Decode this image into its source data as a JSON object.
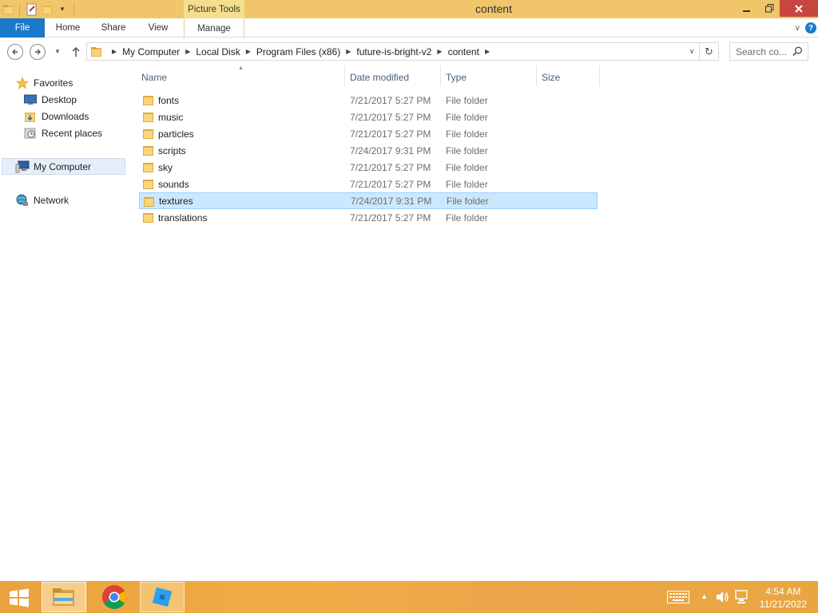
{
  "window": {
    "title": "content",
    "context_tab_group": "Picture Tools"
  },
  "ribbon": {
    "tabs": [
      {
        "label": "File"
      },
      {
        "label": "Home"
      },
      {
        "label": "Share"
      },
      {
        "label": "View"
      },
      {
        "label": "Manage"
      }
    ]
  },
  "address": {
    "breadcrumbs": [
      "My Computer",
      "Local Disk",
      "Program Files (x86)",
      "future-is-bright-v2",
      "content"
    ],
    "search_placeholder": "Search co..."
  },
  "navpane": {
    "favorites": "Favorites",
    "desktop": "Desktop",
    "downloads": "Downloads",
    "recent": "Recent places",
    "mycomputer": "My Computer",
    "network": "Network"
  },
  "columns": {
    "name": "Name",
    "date": "Date modified",
    "type": "Type",
    "size": "Size"
  },
  "files": [
    {
      "name": "fonts",
      "date": "7/21/2017 5:27 PM",
      "type": "File folder",
      "selected": false
    },
    {
      "name": "music",
      "date": "7/21/2017 5:27 PM",
      "type": "File folder",
      "selected": false
    },
    {
      "name": "particles",
      "date": "7/21/2017 5:27 PM",
      "type": "File folder",
      "selected": false
    },
    {
      "name": "scripts",
      "date": "7/24/2017 9:31 PM",
      "type": "File folder",
      "selected": false
    },
    {
      "name": "sky",
      "date": "7/21/2017 5:27 PM",
      "type": "File folder",
      "selected": false
    },
    {
      "name": "sounds",
      "date": "7/21/2017 5:27 PM",
      "type": "File folder",
      "selected": false
    },
    {
      "name": "textures",
      "date": "7/24/2017 9:31 PM",
      "type": "File folder",
      "selected": true
    },
    {
      "name": "translations",
      "date": "7/21/2017 5:27 PM",
      "type": "File folder",
      "selected": false
    }
  ],
  "taskbar": {
    "time": "4:54 AM",
    "date": "11/21/2022",
    "apps": [
      "file-explorer-icon",
      "chrome-icon",
      "roblox-studio-icon"
    ]
  },
  "colors": {
    "titlebar": "#f1c56a",
    "file_tab": "#1979ca",
    "selection": "#cce8ff",
    "taskbar": "#eba64a"
  }
}
